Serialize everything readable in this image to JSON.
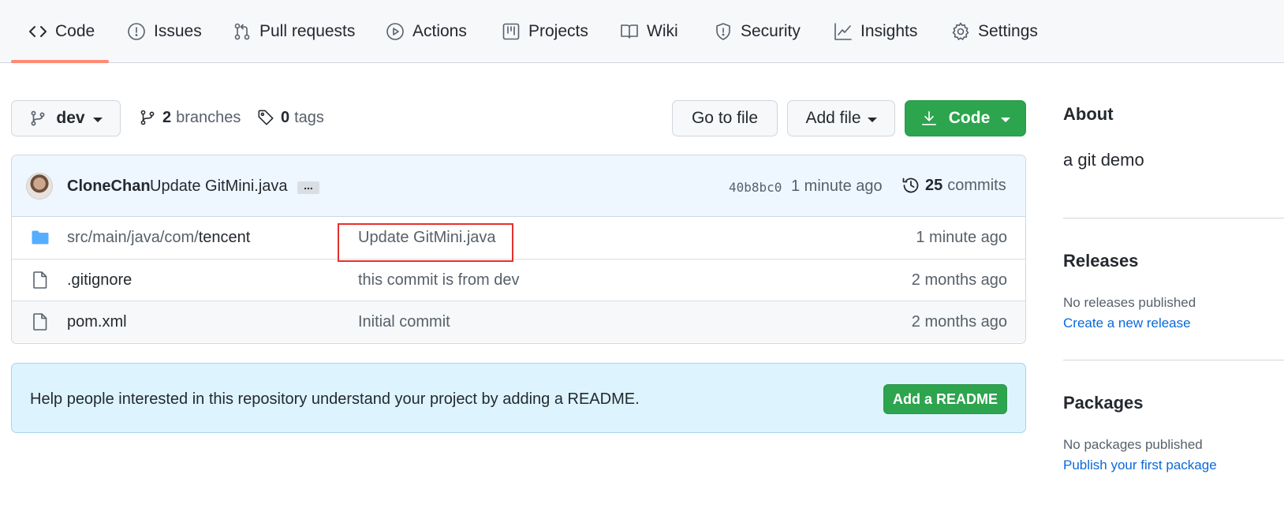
{
  "nav": {
    "tabs": [
      {
        "label": "Code",
        "icon": "code-icon",
        "active": true
      },
      {
        "label": "Issues",
        "icon": "issue-opened-icon"
      },
      {
        "label": "Pull requests",
        "icon": "git-pull-request-icon"
      },
      {
        "label": "Actions",
        "icon": "play-icon"
      },
      {
        "label": "Projects",
        "icon": "table-icon"
      },
      {
        "label": "Wiki",
        "icon": "book-icon"
      },
      {
        "label": "Security",
        "icon": "shield-icon"
      },
      {
        "label": "Insights",
        "icon": "graph-icon"
      },
      {
        "label": "Settings",
        "icon": "gear-icon"
      }
    ],
    "active_underline_color": "#fd8c73"
  },
  "toolbar": {
    "branch_label": "dev",
    "branches_count": "2",
    "branches_label": "branches",
    "tags_count": "0",
    "tags_label": "tags",
    "go_to_file_label": "Go to file",
    "add_file_label": "Add file",
    "code_label": "Code"
  },
  "latest_commit": {
    "author": "CloneChan",
    "message": "Update GitMini.java",
    "ellipsis": "...",
    "sha": "40b8bc0",
    "time": "1 minute ago",
    "commits_count": "25",
    "commits_label": "commits"
  },
  "files": [
    {
      "type": "folder",
      "name_prefix": "src/main/java/com/",
      "name": "tencent",
      "message": "Update GitMini.java",
      "time": "1 minute ago"
    },
    {
      "type": "file",
      "name_prefix": "",
      "name": ".gitignore",
      "message": "this commit is from dev",
      "time": "2 months ago"
    },
    {
      "type": "file",
      "name_prefix": "",
      "name": "pom.xml",
      "message": "Initial commit",
      "time": "2 months ago"
    }
  ],
  "readme_banner": {
    "text": "Help people interested in this repository understand your project by adding a README.",
    "button_label": "Add a README"
  },
  "sidebar": {
    "about_heading": "About",
    "description": "a git demo",
    "releases_heading": "Releases",
    "releases_none": "No releases published",
    "releases_link": "Create a new release",
    "packages_heading": "Packages",
    "packages_none": "No packages published",
    "packages_link": "Publish your first package"
  },
  "colors": {
    "primary_green": "#2da44e",
    "link_blue": "#0969da",
    "highlight_red": "#e5302f",
    "folder_blue": "#54aeff"
  }
}
